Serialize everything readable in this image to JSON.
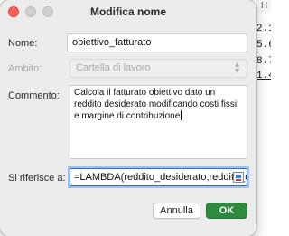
{
  "background_sheet": {
    "column_header": "H",
    "cells": [
      "2.1",
      "5.6",
      "8.7",
      "1.4"
    ]
  },
  "dialog": {
    "title": "Modifica nome",
    "name": {
      "label": "Nome:",
      "value": "obiettivo_fatturato"
    },
    "scope": {
      "label": "Ambito:",
      "value": "Cartella di lavoro",
      "disabled": true
    },
    "comment": {
      "label": "Commento:",
      "value": "Calcola il fatturato obiettivo dato un reddito desiderato modificando costi fissi e margine di contribuzione"
    },
    "refers_to": {
      "label": "Si riferisce a:",
      "value": "=LAMBDA(reddito_desiderato;reddito_ope"
    },
    "buttons": {
      "cancel": "Annulla",
      "ok": "OK"
    }
  },
  "colors": {
    "ok_button": "#2f8a3f",
    "close_dot": "#ff5f57",
    "focus_ring": "#2b72d6"
  }
}
